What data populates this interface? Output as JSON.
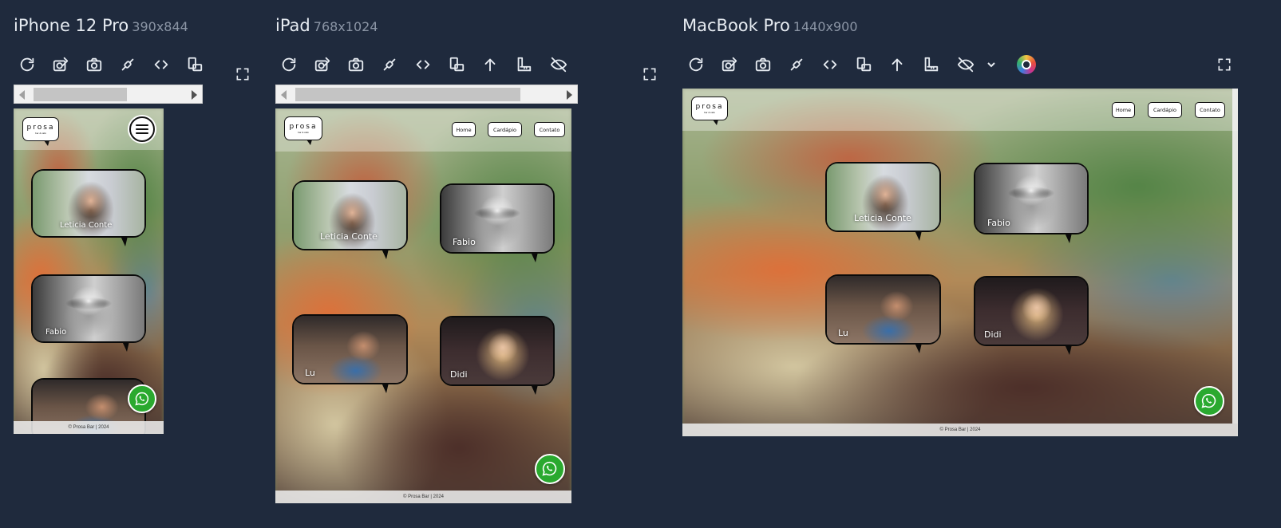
{
  "devices": [
    {
      "name": "iPhone 12 Pro",
      "dims": "390x844"
    },
    {
      "name": "iPad",
      "dims": "768x1024"
    },
    {
      "name": "MacBook Pro",
      "dims": "1440x900"
    }
  ],
  "toolbar_icons": [
    "refresh-icon",
    "screenshot-edit-icon",
    "camera-icon",
    "sync-scroll-icon",
    "source-code-icon",
    "rotate-device-icon",
    "scroll-top-icon",
    "ruler-icon",
    "hide-icon",
    "chevron-down-icon",
    "color-picker-icon",
    "expand-icon"
  ],
  "site": {
    "logo": {
      "word": "prosa",
      "sub": "bar & café"
    },
    "nav": [
      "Home",
      "Cardápio",
      "Contato"
    ],
    "footer": "© Prosa Bar | 2024",
    "people": [
      "Leticia Conte",
      "Fabio",
      "Lu",
      "Didi"
    ]
  },
  "colors": {
    "background": "#1f2a3d",
    "whatsapp": "#2aa92f",
    "bubble_border": "#0a0a0a"
  }
}
